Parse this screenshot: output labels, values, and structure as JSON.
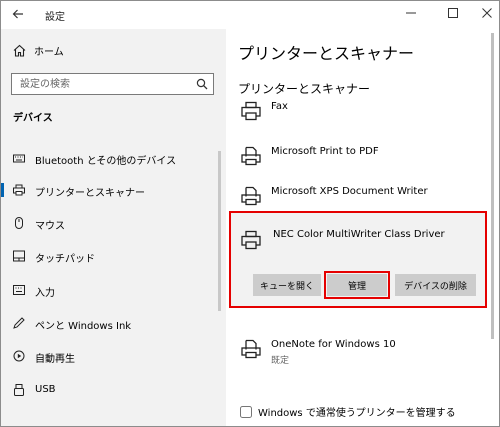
{
  "title_bar": {
    "app_title": "設定"
  },
  "sidebar": {
    "home_label": "ホーム",
    "search_placeholder": "設定の検索",
    "section_title": "デバイス",
    "items": [
      {
        "label": "Bluetooth とその他のデバイス",
        "icon": "keyboard-icon"
      },
      {
        "label": "プリンターとスキャナー",
        "icon": "printer-icon",
        "active": true
      },
      {
        "label": "マウス",
        "icon": "mouse-icon"
      },
      {
        "label": "タッチパッド",
        "icon": "touchpad-icon"
      },
      {
        "label": "入力",
        "icon": "input-icon"
      },
      {
        "label": "ペンと Windows Ink",
        "icon": "pen-icon"
      },
      {
        "label": "自動再生",
        "icon": "autoplay-icon"
      },
      {
        "label": "USB",
        "icon": "usb-icon"
      }
    ]
  },
  "main": {
    "page_title": "プリンターとスキャナー",
    "section_title": "プリンターとスキャナー",
    "printers": [
      {
        "name": "Fax",
        "icon": "printer-icon"
      },
      {
        "name": "Microsoft Print to PDF",
        "icon": "printer-document-icon"
      },
      {
        "name": "Microsoft XPS Document Writer",
        "icon": "printer-document-icon"
      },
      {
        "name": "NEC Color MultiWriter Class Driver",
        "icon": "printer-icon",
        "selected": true
      },
      {
        "name": "OneNote for Windows 10",
        "sub": "既定",
        "icon": "printer-document-icon"
      }
    ],
    "buttons": {
      "open_queue": "キューを開く",
      "manage": "管理",
      "remove_device": "デバイスの削除"
    },
    "checkbox_label": "Windows で通常使うプリンターを管理する",
    "checkbox_checked": false
  },
  "colors": {
    "highlight": "#e50000",
    "accent": "#0063b1",
    "sidebar_bg": "#f2f2f2",
    "button_bg": "#cccccc"
  }
}
